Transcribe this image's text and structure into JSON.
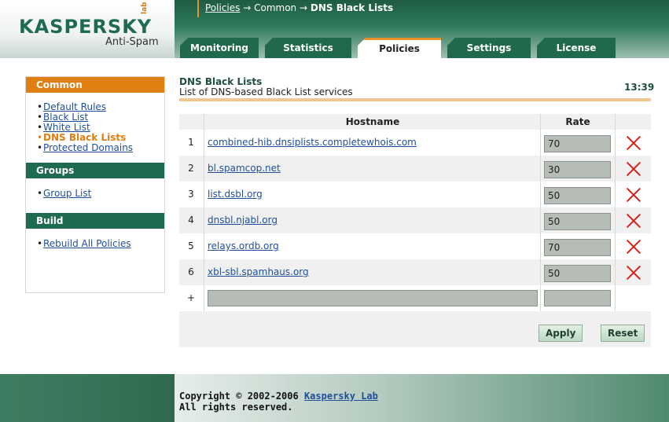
{
  "brand": {
    "logo": "KASPERSKY",
    "logo_lab": "lab",
    "product": "Anti-Spam"
  },
  "breadcrumb": {
    "part1": "Policies",
    "arrow1": "→",
    "part2": "Common",
    "arrow2": "→",
    "current": "DNS Black Lists"
  },
  "tabs": [
    {
      "label": "Monitoring"
    },
    {
      "label": "Statistics"
    },
    {
      "label": "Policies",
      "active": true
    },
    {
      "label": "Settings"
    },
    {
      "label": "License"
    }
  ],
  "sidebar": {
    "common": {
      "title": "Common",
      "items": [
        {
          "label": "Default Rules"
        },
        {
          "label": "Black List"
        },
        {
          "label": "White List"
        },
        {
          "label": "DNS Black Lists",
          "current": true
        },
        {
          "label": "Protected Domains"
        }
      ]
    },
    "groups": {
      "title": "Groups",
      "items": [
        {
          "label": "Group List"
        }
      ]
    },
    "build": {
      "title": "Build",
      "items": [
        {
          "label": "Rebuild All Policies"
        }
      ]
    }
  },
  "main": {
    "title": "DNS Black Lists",
    "subtitle": "List of DNS-based Black List services",
    "clock": "13:39",
    "columns": {
      "hostname": "Hostname",
      "rate": "Rate"
    },
    "rows": [
      {
        "num": "1",
        "host": "combined-hib.dnsiplists.completewhois.com",
        "rate": "70"
      },
      {
        "num": "2",
        "host": "bl.spamcop.net",
        "rate": "30"
      },
      {
        "num": "3",
        "host": "list.dsbl.org",
        "rate": "50"
      },
      {
        "num": "4",
        "host": "dnsbl.njabl.org",
        "rate": "50"
      },
      {
        "num": "5",
        "host": "relays.ordb.org",
        "rate": "70"
      },
      {
        "num": "6",
        "host": "xbl-sbl.spamhaus.org",
        "rate": "50"
      }
    ],
    "add_symbol": "+",
    "apply_label": "Apply",
    "reset_label": "Reset"
  },
  "footer": {
    "copyright": "Copyright © 2002-2006",
    "company": "Kaspersky Lab",
    "rights": "All rights reserved."
  },
  "colors": {
    "brand_green": "#1f6b4f",
    "accent_orange": "#e07e10",
    "delete_red": "#d91f1a",
    "input_gray": "#b5bdb6"
  }
}
